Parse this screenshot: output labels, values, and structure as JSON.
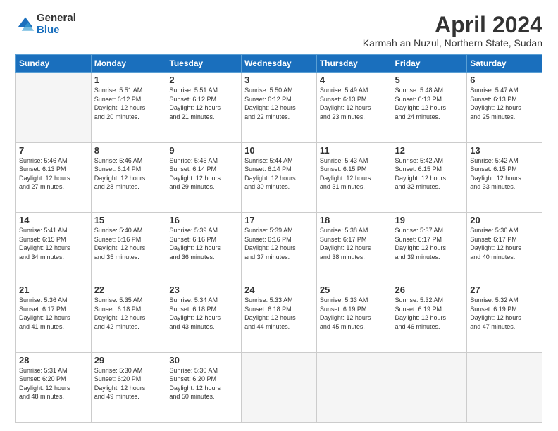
{
  "logo": {
    "general": "General",
    "blue": "Blue"
  },
  "title": "April 2024",
  "subtitle": "Karmah an Nuzul, Northern State, Sudan",
  "days_header": [
    "Sunday",
    "Monday",
    "Tuesday",
    "Wednesday",
    "Thursday",
    "Friday",
    "Saturday"
  ],
  "weeks": [
    [
      {
        "day": "",
        "info": ""
      },
      {
        "day": "1",
        "info": "Sunrise: 5:51 AM\nSunset: 6:12 PM\nDaylight: 12 hours\nand 20 minutes."
      },
      {
        "day": "2",
        "info": "Sunrise: 5:51 AM\nSunset: 6:12 PM\nDaylight: 12 hours\nand 21 minutes."
      },
      {
        "day": "3",
        "info": "Sunrise: 5:50 AM\nSunset: 6:12 PM\nDaylight: 12 hours\nand 22 minutes."
      },
      {
        "day": "4",
        "info": "Sunrise: 5:49 AM\nSunset: 6:13 PM\nDaylight: 12 hours\nand 23 minutes."
      },
      {
        "day": "5",
        "info": "Sunrise: 5:48 AM\nSunset: 6:13 PM\nDaylight: 12 hours\nand 24 minutes."
      },
      {
        "day": "6",
        "info": "Sunrise: 5:47 AM\nSunset: 6:13 PM\nDaylight: 12 hours\nand 25 minutes."
      }
    ],
    [
      {
        "day": "7",
        "info": "Sunrise: 5:46 AM\nSunset: 6:13 PM\nDaylight: 12 hours\nand 27 minutes."
      },
      {
        "day": "8",
        "info": "Sunrise: 5:46 AM\nSunset: 6:14 PM\nDaylight: 12 hours\nand 28 minutes."
      },
      {
        "day": "9",
        "info": "Sunrise: 5:45 AM\nSunset: 6:14 PM\nDaylight: 12 hours\nand 29 minutes."
      },
      {
        "day": "10",
        "info": "Sunrise: 5:44 AM\nSunset: 6:14 PM\nDaylight: 12 hours\nand 30 minutes."
      },
      {
        "day": "11",
        "info": "Sunrise: 5:43 AM\nSunset: 6:15 PM\nDaylight: 12 hours\nand 31 minutes."
      },
      {
        "day": "12",
        "info": "Sunrise: 5:42 AM\nSunset: 6:15 PM\nDaylight: 12 hours\nand 32 minutes."
      },
      {
        "day": "13",
        "info": "Sunrise: 5:42 AM\nSunset: 6:15 PM\nDaylight: 12 hours\nand 33 minutes."
      }
    ],
    [
      {
        "day": "14",
        "info": "Sunrise: 5:41 AM\nSunset: 6:15 PM\nDaylight: 12 hours\nand 34 minutes."
      },
      {
        "day": "15",
        "info": "Sunrise: 5:40 AM\nSunset: 6:16 PM\nDaylight: 12 hours\nand 35 minutes."
      },
      {
        "day": "16",
        "info": "Sunrise: 5:39 AM\nSunset: 6:16 PM\nDaylight: 12 hours\nand 36 minutes."
      },
      {
        "day": "17",
        "info": "Sunrise: 5:39 AM\nSunset: 6:16 PM\nDaylight: 12 hours\nand 37 minutes."
      },
      {
        "day": "18",
        "info": "Sunrise: 5:38 AM\nSunset: 6:17 PM\nDaylight: 12 hours\nand 38 minutes."
      },
      {
        "day": "19",
        "info": "Sunrise: 5:37 AM\nSunset: 6:17 PM\nDaylight: 12 hours\nand 39 minutes."
      },
      {
        "day": "20",
        "info": "Sunrise: 5:36 AM\nSunset: 6:17 PM\nDaylight: 12 hours\nand 40 minutes."
      }
    ],
    [
      {
        "day": "21",
        "info": "Sunrise: 5:36 AM\nSunset: 6:17 PM\nDaylight: 12 hours\nand 41 minutes."
      },
      {
        "day": "22",
        "info": "Sunrise: 5:35 AM\nSunset: 6:18 PM\nDaylight: 12 hours\nand 42 minutes."
      },
      {
        "day": "23",
        "info": "Sunrise: 5:34 AM\nSunset: 6:18 PM\nDaylight: 12 hours\nand 43 minutes."
      },
      {
        "day": "24",
        "info": "Sunrise: 5:33 AM\nSunset: 6:18 PM\nDaylight: 12 hours\nand 44 minutes."
      },
      {
        "day": "25",
        "info": "Sunrise: 5:33 AM\nSunset: 6:19 PM\nDaylight: 12 hours\nand 45 minutes."
      },
      {
        "day": "26",
        "info": "Sunrise: 5:32 AM\nSunset: 6:19 PM\nDaylight: 12 hours\nand 46 minutes."
      },
      {
        "day": "27",
        "info": "Sunrise: 5:32 AM\nSunset: 6:19 PM\nDaylight: 12 hours\nand 47 minutes."
      }
    ],
    [
      {
        "day": "28",
        "info": "Sunrise: 5:31 AM\nSunset: 6:20 PM\nDaylight: 12 hours\nand 48 minutes."
      },
      {
        "day": "29",
        "info": "Sunrise: 5:30 AM\nSunset: 6:20 PM\nDaylight: 12 hours\nand 49 minutes."
      },
      {
        "day": "30",
        "info": "Sunrise: 5:30 AM\nSunset: 6:20 PM\nDaylight: 12 hours\nand 50 minutes."
      },
      {
        "day": "",
        "info": ""
      },
      {
        "day": "",
        "info": ""
      },
      {
        "day": "",
        "info": ""
      },
      {
        "day": "",
        "info": ""
      }
    ]
  ]
}
